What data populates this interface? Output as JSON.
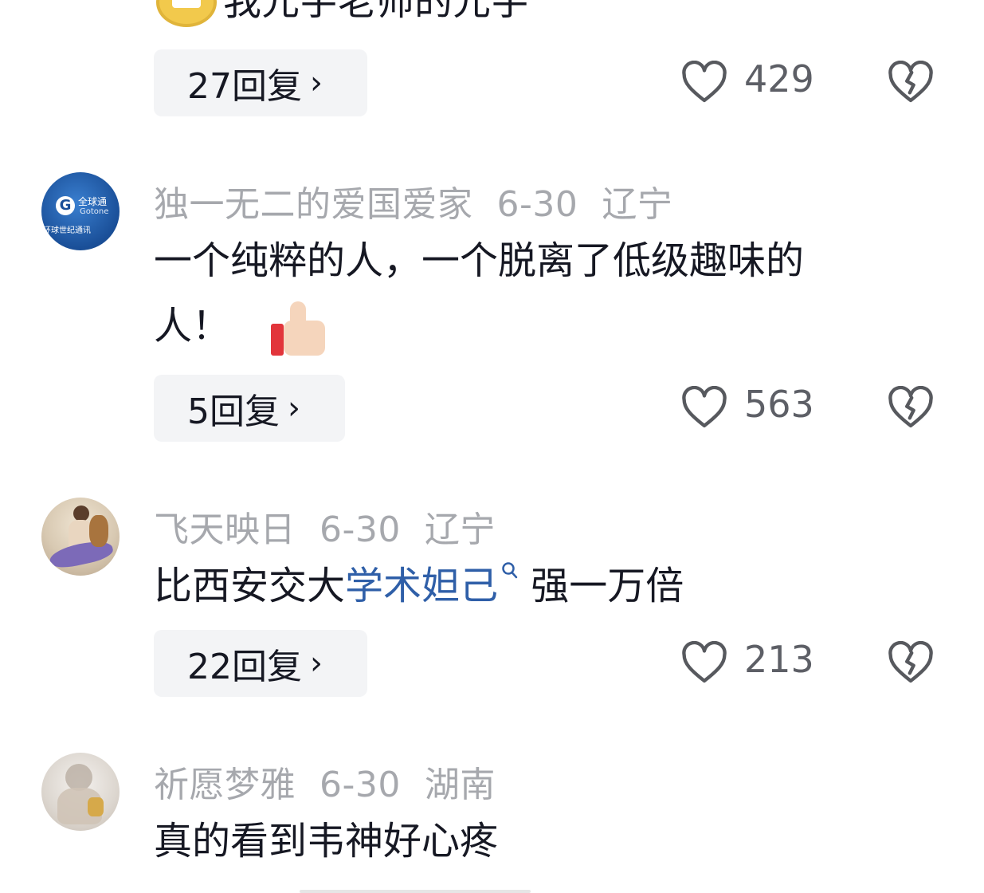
{
  "comments": [
    {
      "text_partial": "我元宇老师的元宇",
      "reply_label": "27回复",
      "likes": "429"
    },
    {
      "username": "独一无二的爱国爱家",
      "date": "6-30",
      "location": "辽宁",
      "text_line1": "一个纯粹的人，一个脱离了低级趣味的",
      "text_line2": "人！",
      "reply_label": "5回复",
      "likes": "563",
      "avatar_text": "全球通",
      "avatar_subtext": "Gotone",
      "avatar_caption": "环球世纪通讯"
    },
    {
      "username": "飞天映日",
      "date": "6-30",
      "location": "辽宁",
      "text_before": "比西安交大",
      "text_link": "学术妲己",
      "text_after": " 强一万倍",
      "reply_label": "22回复",
      "likes": "213"
    },
    {
      "username": "祈愿梦雅",
      "date": "6-30",
      "location": "湖南",
      "text": "真的看到韦神好心疼"
    }
  ],
  "icons": {
    "like": "heart-outline-icon",
    "dislike": "broken-heart-icon",
    "search": "search-icon",
    "thumbs_up": "thumbs-up-emoji",
    "chevron": "chevron-right-icon"
  },
  "colors": {
    "meta": "#a6a8ad",
    "link": "#2f5fa8",
    "button_bg": "#f3f4f6",
    "text": "#161823"
  }
}
